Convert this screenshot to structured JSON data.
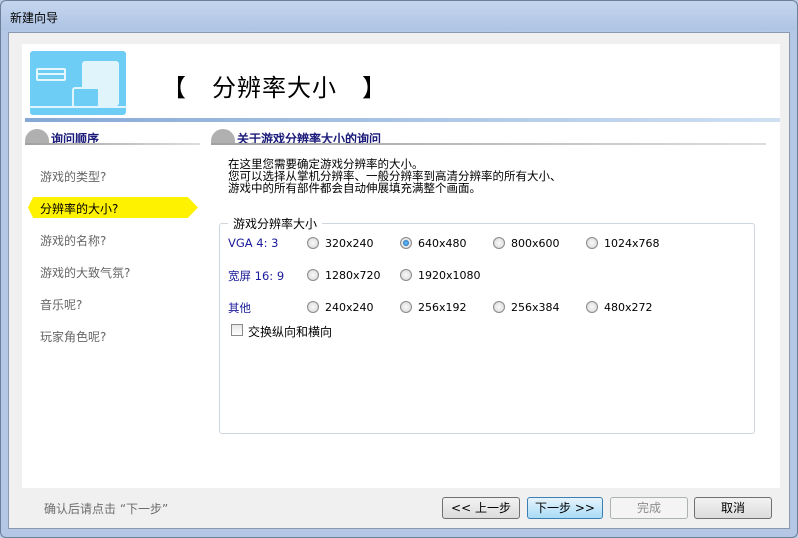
{
  "window": {
    "title": "新建向导"
  },
  "header": {
    "title": "【　分辨率大小　】"
  },
  "sidebar": {
    "heading": "询问顺序",
    "items": [
      {
        "label": "游戏的类型?",
        "selected": false
      },
      {
        "label": "分辨率的大小?",
        "selected": true
      },
      {
        "label": "游戏的名称?",
        "selected": false
      },
      {
        "label": "游戏的大致气氛?",
        "selected": false
      },
      {
        "label": "音乐呢?",
        "selected": false
      },
      {
        "label": "玩家角色呢?",
        "selected": false
      }
    ]
  },
  "main": {
    "heading": "关于游戏分辨率大小的询问",
    "description": [
      "在这里您需要确定游戏分辨率的大小。",
      "您可以选择从掌机分辨率、一般分辨率到高清分辨率的所有大小、",
      "游戏中的所有部件都会自动伸展填充满整个画面。"
    ],
    "group_title": "游戏分辨率大小",
    "rows": [
      {
        "label": "VGA 4: 3",
        "options": [
          "320x240",
          "640x480",
          "800x600",
          "1024x768"
        ]
      },
      {
        "label": "宽屏 16: 9",
        "options": [
          "1280x720",
          "1920x1080"
        ]
      },
      {
        "label": "其他",
        "options": [
          "240x240",
          "256x192",
          "256x384",
          "480x272"
        ]
      }
    ],
    "selected": "640x480",
    "swap_checkbox": {
      "label": "交换纵向和横向",
      "checked": false
    }
  },
  "footer": {
    "hint": "确认后请点击 “下一步”",
    "back": "<< 上一步",
    "next": "下一步 >>",
    "finish": "完成",
    "cancel": "取消"
  }
}
